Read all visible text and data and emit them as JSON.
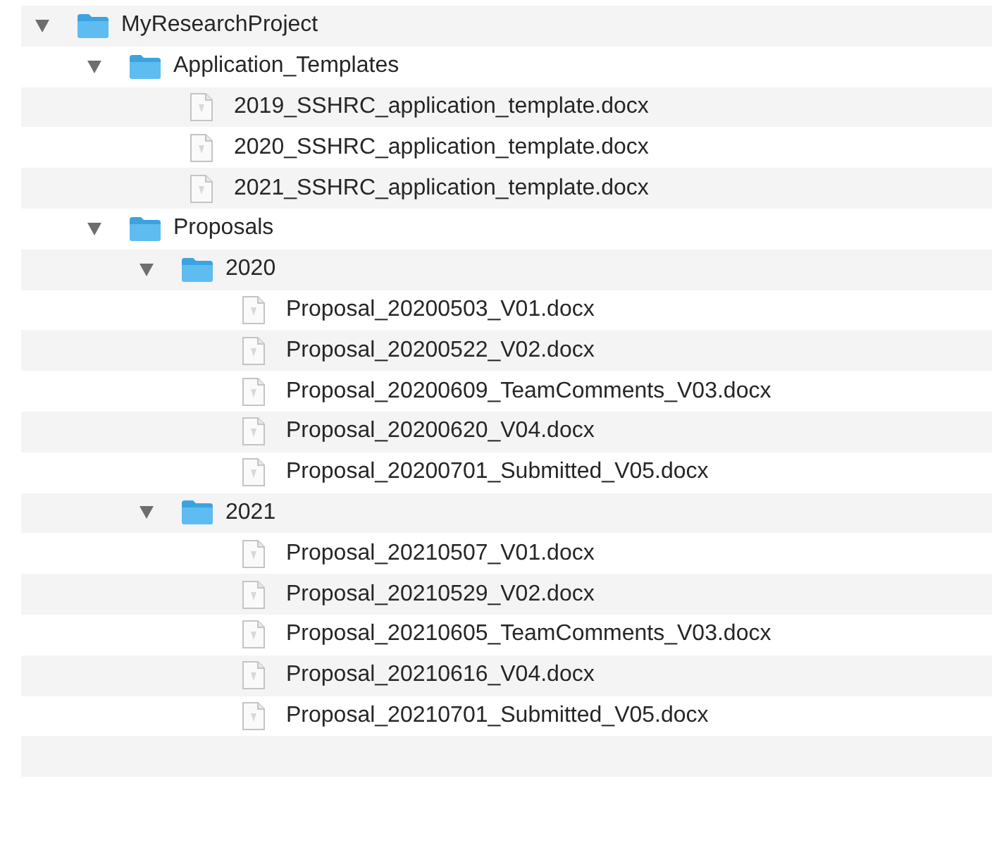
{
  "tree": [
    {
      "kind": "folder",
      "name": "MyResearchProject",
      "expanded": true,
      "children": [
        {
          "kind": "folder",
          "name": "Application_Templates",
          "expanded": true,
          "children": [
            {
              "kind": "file",
              "name": "2019_SSHRC_application_template.docx"
            },
            {
              "kind": "file",
              "name": "2020_SSHRC_application_template.docx"
            },
            {
              "kind": "file",
              "name": "2021_SSHRC_application_template.docx"
            }
          ]
        },
        {
          "kind": "folder",
          "name": "Proposals",
          "expanded": true,
          "children": [
            {
              "kind": "folder",
              "name": "2020",
              "expanded": true,
              "children": [
                {
                  "kind": "file",
                  "name": "Proposal_20200503_V01.docx"
                },
                {
                  "kind": "file",
                  "name": "Proposal_20200522_V02.docx"
                },
                {
                  "kind": "file",
                  "name": "Proposal_20200609_TeamComments_V03.docx"
                },
                {
                  "kind": "file",
                  "name": "Proposal_20200620_V04.docx"
                },
                {
                  "kind": "file",
                  "name": "Proposal_20200701_Submitted_V05.docx"
                }
              ]
            },
            {
              "kind": "folder",
              "name": "2021",
              "expanded": true,
              "children": [
                {
                  "kind": "file",
                  "name": "Proposal_20210507_V01.docx"
                },
                {
                  "kind": "file",
                  "name": "Proposal_20210529_V02.docx"
                },
                {
                  "kind": "file",
                  "name": "Proposal_20210605_TeamComments_V03.docx"
                },
                {
                  "kind": "file",
                  "name": "Proposal_20210616_V04.docx"
                },
                {
                  "kind": "file",
                  "name": "Proposal_20210701_Submitted_V05.docx"
                }
              ]
            }
          ]
        }
      ]
    }
  ]
}
